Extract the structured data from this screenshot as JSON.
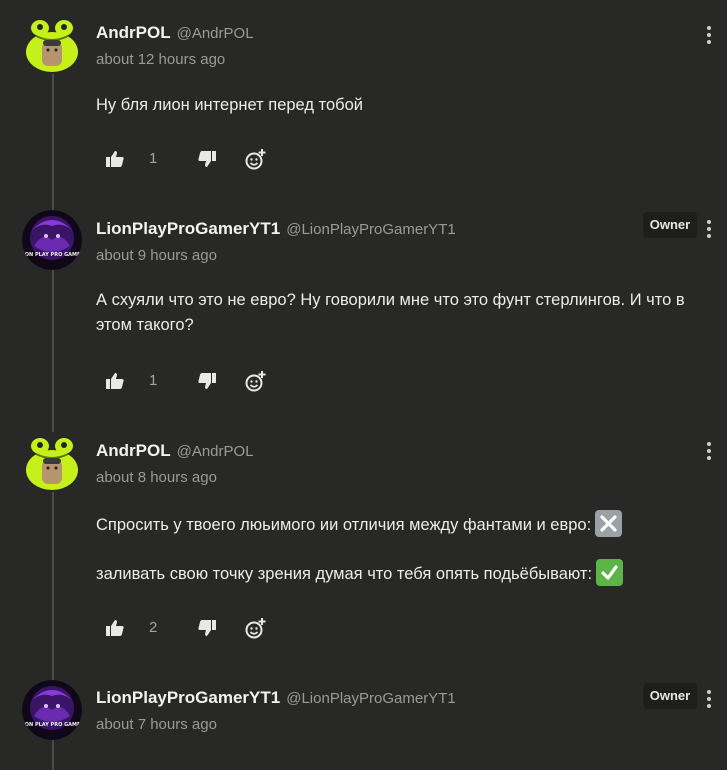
{
  "comments": [
    {
      "author": "AndrPOL",
      "handle": "@AndrPOL",
      "time": "about 12 hours ago",
      "lines": [
        "Ну бля лион интернет перед тобой"
      ],
      "likes": "1",
      "avatar": "frog-avatar"
    },
    {
      "author": "LionPlayProGamerYT1",
      "handle": "@LionPlayProGamerYT1",
      "badge": "Owner",
      "time": "about 9 hours ago",
      "lines": [
        "А схуяли что это не евро? Ну говорили мне что это фунт стерлингов. И что в этом такого?"
      ],
      "likes": "1",
      "avatar": "lion-avatar"
    },
    {
      "author": "AndrPOL",
      "handle": "@AndrPOL",
      "time": "about 8 hours ago",
      "lines": [
        "Спросить у твоего люьимого ии отличия между фантами и евро:",
        "заливать свою точку зрения думая что тебя опять подьёбывают:"
      ],
      "emojis": [
        "cross-mark-emoji",
        "check-mark-emoji"
      ],
      "likes": "2",
      "avatar": "frog-avatar"
    },
    {
      "author": "LionPlayProGamerYT1",
      "handle": "@LionPlayProGamerYT1",
      "badge": "Owner",
      "time": "about 7 hours ago",
      "avatar": "lion-avatar"
    }
  ],
  "avatar_lettering": "LION PLAY PRO GAMER",
  "colors": {
    "background": "#282826",
    "frog_green": "#c6f01a",
    "check_green": "#5bb546",
    "lion_purple": "#6a2bb0"
  }
}
